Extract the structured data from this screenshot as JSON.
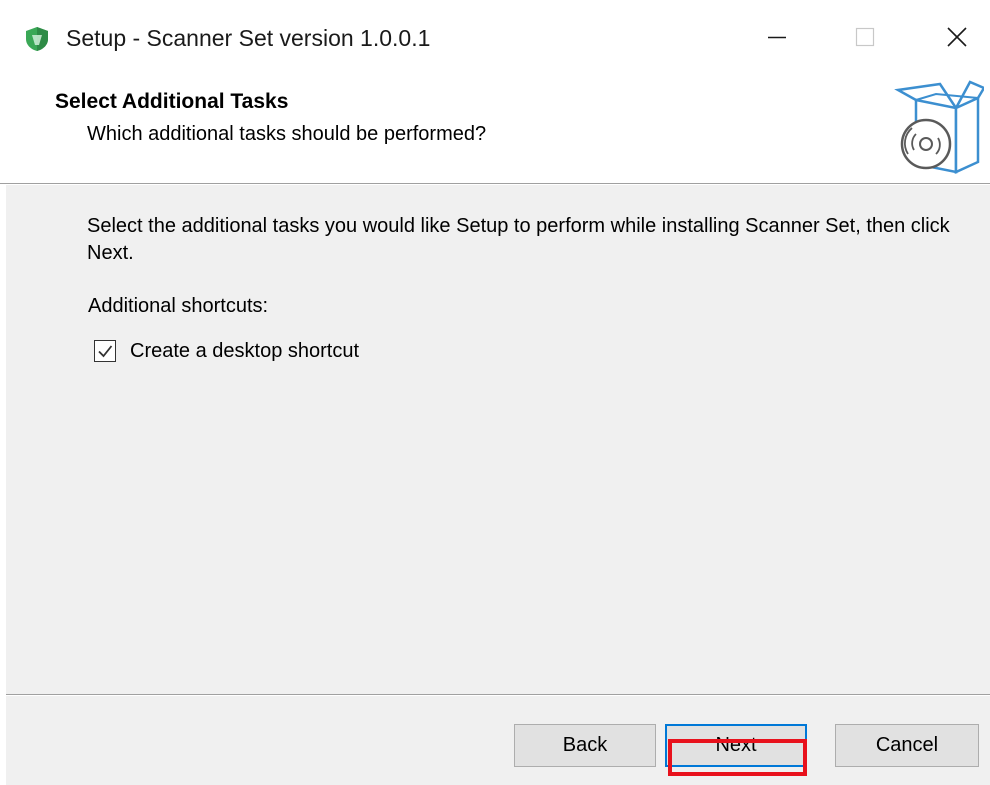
{
  "window": {
    "title": "Setup - Scanner Set version 1.0.0.1",
    "app_icon": "shield-installer-icon",
    "controls": {
      "minimize": "minimize-icon",
      "maximize": "maximize-icon",
      "close": "close-icon"
    }
  },
  "header": {
    "title": "Select Additional Tasks",
    "subtitle": "Which additional tasks should be performed?",
    "icon": "software-box-disc-icon"
  },
  "body": {
    "description": "Select the additional tasks you would like Setup to perform while installing Scanner Set, then click Next.",
    "section_label": "Additional shortcuts:",
    "tasks": [
      {
        "label": "Create a desktop shortcut",
        "checked": true
      }
    ]
  },
  "footer": {
    "back_label": "Back",
    "next_label": "Next",
    "cancel_label": "Cancel"
  },
  "colors": {
    "accent": "#0078d7",
    "highlight": "#e8111c",
    "panel": "#f0f0f0"
  }
}
